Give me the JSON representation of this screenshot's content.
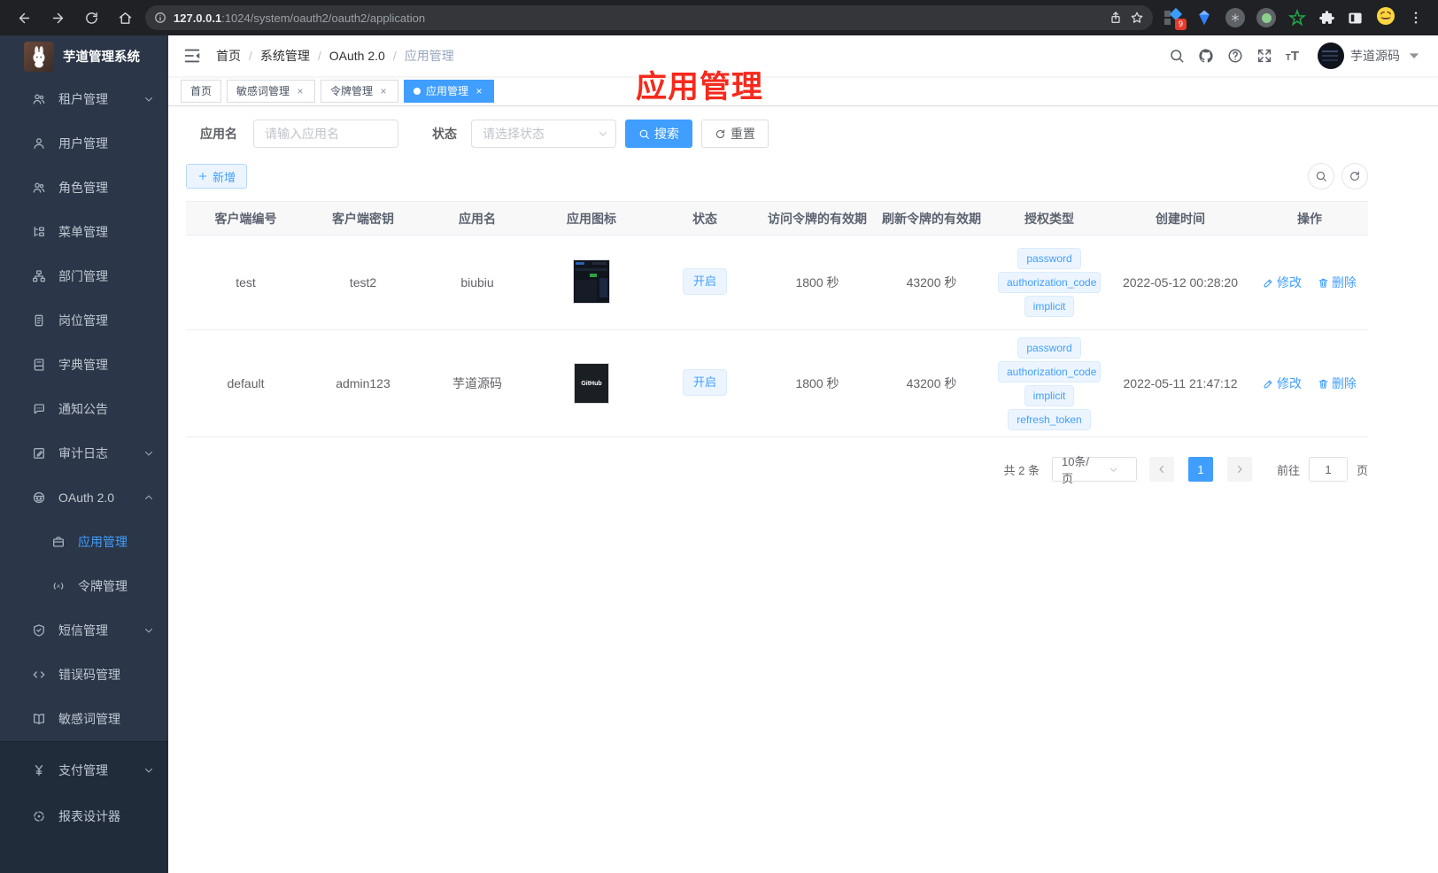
{
  "browser": {
    "url_domain": "127.0.0.1",
    "url_rest": ":1024/system/oauth2/oauth2/application",
    "extension_badge": "9"
  },
  "app": {
    "accent_color": "#409eff",
    "annotation": {
      "text": "应用管理",
      "color": "#f42a1d"
    }
  },
  "sidebar": {
    "logo_title": "芋道管理系统",
    "items": [
      {
        "label": "租户管理",
        "icon": "peoples-icon",
        "has_arrow": true
      },
      {
        "label": "用户管理",
        "icon": "user-icon"
      },
      {
        "label": "角色管理",
        "icon": "peoples-icon"
      },
      {
        "label": "菜单管理",
        "icon": "tree-table-icon"
      },
      {
        "label": "部门管理",
        "icon": "org-tree-icon"
      },
      {
        "label": "岗位管理",
        "icon": "post-icon"
      },
      {
        "label": "字典管理",
        "icon": "dict-icon"
      },
      {
        "label": "通知公告",
        "icon": "message-icon"
      },
      {
        "label": "审计日志",
        "icon": "log-icon",
        "has_arrow": true
      },
      {
        "label": "OAuth 2.0",
        "icon": "client-icon",
        "has_arrow": true,
        "expanded": true
      },
      {
        "label": "应用管理",
        "icon": "briefcase-icon",
        "child": true,
        "active": true
      },
      {
        "label": "令牌管理",
        "icon": "token-icon",
        "child": true
      },
      {
        "label": "短信管理",
        "icon": "shield-icon",
        "has_arrow": true
      },
      {
        "label": "错误码管理",
        "icon": "code-icon"
      },
      {
        "label": "敏感词管理",
        "icon": "open-book-icon"
      }
    ],
    "bottom_items": [
      {
        "label": "支付管理",
        "icon": "yen-icon",
        "has_arrow": true
      },
      {
        "label": "报表设计器",
        "icon": "report-icon"
      }
    ]
  },
  "header": {
    "breadcrumb": [
      "首页",
      "系统管理",
      "OAuth 2.0",
      "应用管理"
    ],
    "user_name": "芋道源码"
  },
  "tabs": [
    {
      "label": "首页",
      "closable": false,
      "active": false
    },
    {
      "label": "敏感词管理",
      "closable": true,
      "active": false
    },
    {
      "label": "令牌管理",
      "closable": true,
      "active": false
    },
    {
      "label": "应用管理",
      "closable": true,
      "active": true
    }
  ],
  "filter": {
    "name_label": "应用名",
    "name_placeholder": "请输入应用名",
    "status_label": "状态",
    "status_placeholder": "请选择状态",
    "search_label": "搜索",
    "reset_label": "重置"
  },
  "toolbar": {
    "add_label": "新增"
  },
  "table": {
    "headers": [
      "客户端编号",
      "客户端密钥",
      "应用名",
      "应用图标",
      "状态",
      "访问令牌的有效期",
      "刷新令牌的有效期",
      "授权类型",
      "创建时间",
      "操作"
    ],
    "rows": [
      {
        "client_id": "test",
        "client_secret": "test2",
        "app_name": "biubiu",
        "app_icon": "dashboard-screenshot-thumbnail",
        "status": "开启",
        "access_token_validity": "1800 秒",
        "refresh_token_validity": "43200 秒",
        "grant_types": [
          "password",
          "authorization_code",
          "implicit"
        ],
        "created_at": "2022-05-12 00:28:20",
        "edit_label": "修改",
        "delete_label": "删除"
      },
      {
        "client_id": "default",
        "client_secret": "admin123",
        "app_name": "芋道源码",
        "app_icon": "github-logo-thumbnail",
        "app_icon_text": "GitHub",
        "status": "开启",
        "access_token_validity": "1800 秒",
        "refresh_token_validity": "43200 秒",
        "grant_types": [
          "password",
          "authorization_code",
          "implicit",
          "refresh_token"
        ],
        "created_at": "2022-05-11 21:47:12",
        "edit_label": "修改",
        "delete_label": "删除"
      }
    ]
  },
  "pagination": {
    "total_text": "共 2 条",
    "page_size_text": "10条/页",
    "current_page": "1",
    "goto_label": "前往",
    "goto_value": "1",
    "page_unit": "页"
  }
}
